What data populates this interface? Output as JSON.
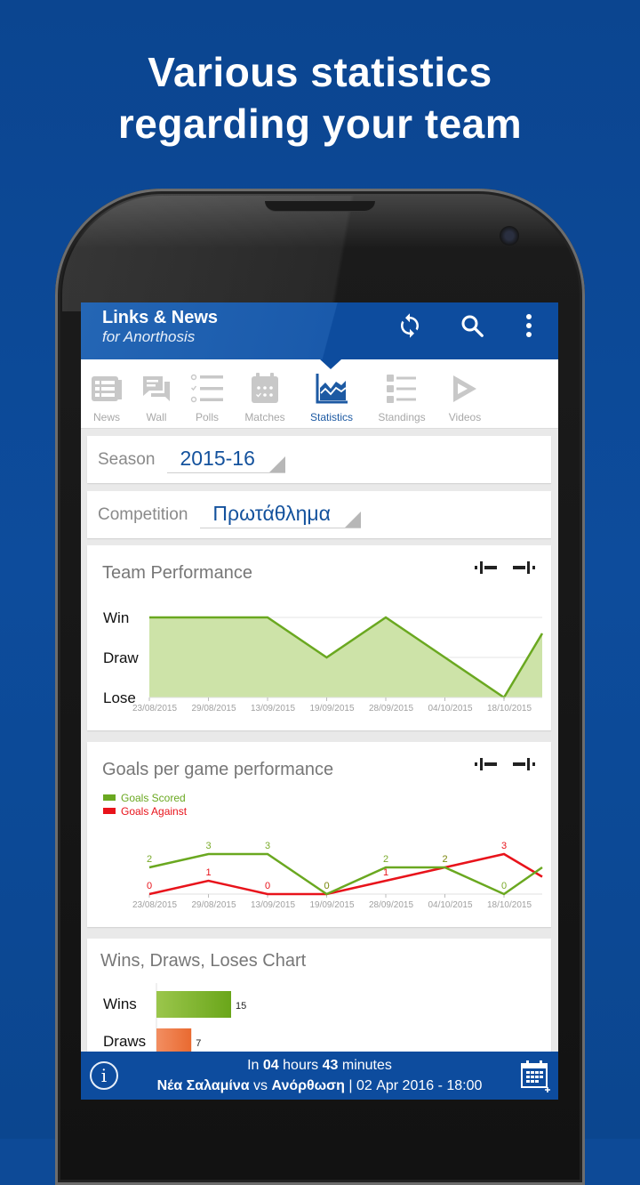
{
  "promo": {
    "headline_line1": "Various statistics",
    "headline_line2": "regarding your team"
  },
  "appbar": {
    "title": "Links & News",
    "subtitle": "for Anorthosis",
    "icons": [
      "refresh-icon",
      "search-icon",
      "more-vert-icon"
    ]
  },
  "tabs": [
    {
      "label": "News",
      "icon": "newspaper-icon",
      "active": false
    },
    {
      "label": "Wall",
      "icon": "chat-icon",
      "active": false
    },
    {
      "label": "Polls",
      "icon": "checklist-icon",
      "active": false
    },
    {
      "label": "Matches",
      "icon": "calendar-icon",
      "active": false
    },
    {
      "label": "Statistics",
      "icon": "chart-icon",
      "active": true
    },
    {
      "label": "Standings",
      "icon": "numbered-list-icon",
      "active": false
    },
    {
      "label": "Videos",
      "icon": "play-icon",
      "active": false
    }
  ],
  "filters": {
    "season_label": "Season",
    "season_value": "2015-16",
    "competition_label": "Competition",
    "competition_value": "Πρωτάθλημα"
  },
  "colors": {
    "brand_blue": "#0d4c9e",
    "scored_green": "#6aa820",
    "against_red": "#e8131b",
    "draws_orange": "#ee7a45"
  },
  "chart_data": [
    {
      "type": "area",
      "title": "Team Performance",
      "categories": [
        "23/08/2015",
        "29/08/2015",
        "13/09/2015",
        "19/09/2015",
        "28/09/2015",
        "04/10/2015",
        "18/10/2015"
      ],
      "y_labels": [
        "Lose",
        "Draw",
        "Win"
      ],
      "values": [
        "Win",
        "Win",
        "Win",
        "Draw",
        "Win",
        "Draw",
        "Lose"
      ],
      "trailing_partial_value": "Draw-Win (cut off)",
      "grid": true
    },
    {
      "type": "line",
      "title": "Goals per game performance",
      "legend": [
        "Goals Scored",
        "Goals Against"
      ],
      "legend_position": "top-left",
      "categories": [
        "23/08/2015",
        "29/08/2015",
        "13/09/2015",
        "19/09/2015",
        "28/09/2015",
        "04/10/2015",
        "18/10/2015"
      ],
      "series": [
        {
          "name": "Goals Scored",
          "values": [
            2,
            3,
            3,
            0,
            2,
            2,
            0
          ]
        },
        {
          "name": "Goals Against",
          "values": [
            0,
            1,
            0,
            0,
            1,
            2,
            3
          ]
        }
      ],
      "ylim": [
        0,
        3
      ]
    },
    {
      "type": "bar",
      "orientation": "horizontal",
      "title": "Wins, Draws, Loses Chart",
      "categories": [
        "Wins",
        "Draws"
      ],
      "values": [
        15,
        7
      ]
    }
  ],
  "footer": {
    "countdown_prefix": "In ",
    "hours": "04",
    "hours_label": " hours ",
    "minutes": "43",
    "minutes_label": " minutes",
    "home_team": "Νέα Σαλαμίνα",
    "vs": " vs ",
    "away_team": "Ανόρθωση",
    "datetime": " | 02 Apr 2016 - 18:00"
  }
}
